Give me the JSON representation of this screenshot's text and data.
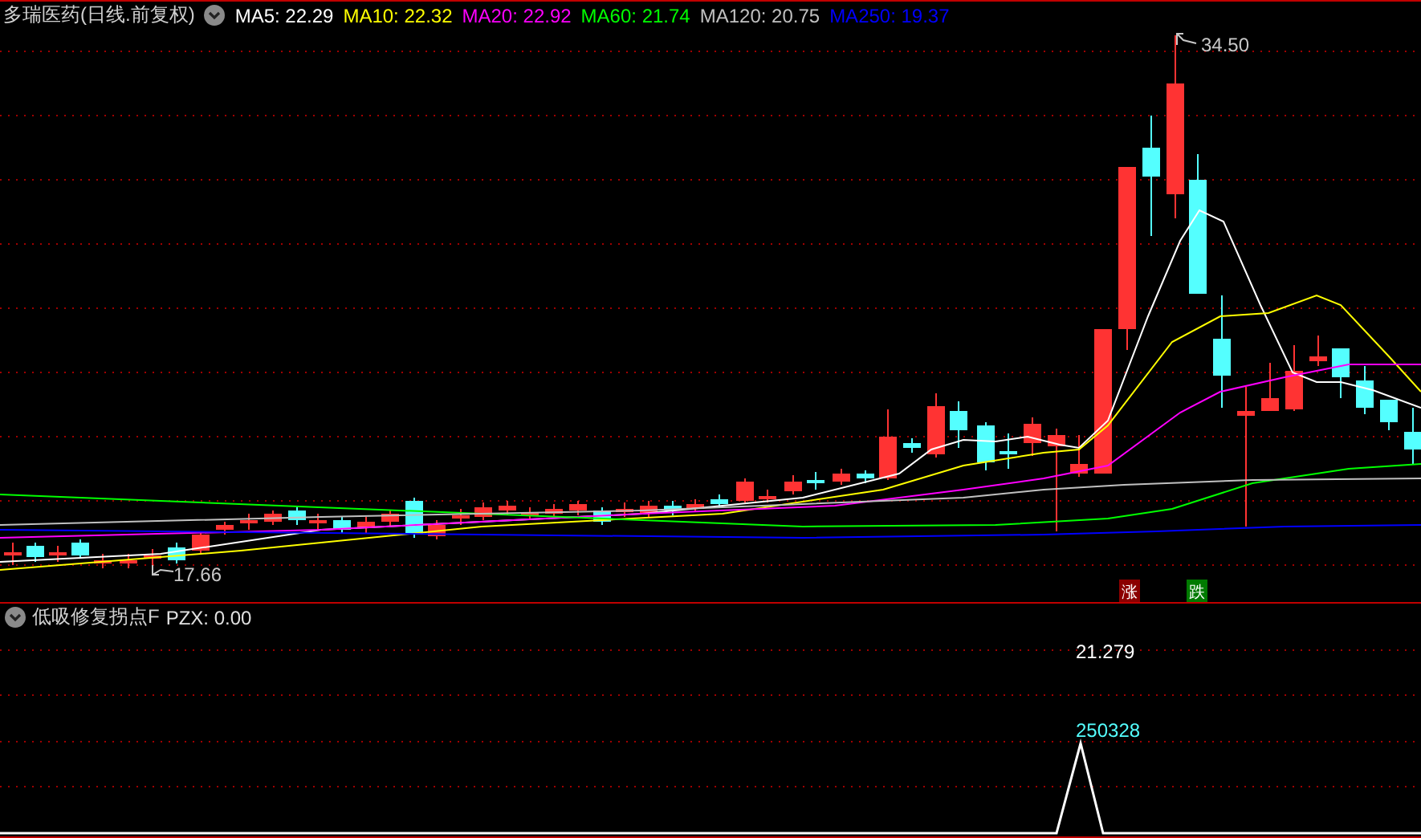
{
  "title": "多瑞医药",
  "period": "(日线.前复权)",
  "ma": [
    {
      "label": "MA5: 22.29",
      "color": "#ffffff"
    },
    {
      "label": "MA10: 22.32",
      "color": "#ffff00"
    },
    {
      "label": "MA20: 22.92",
      "color": "#ff00ff"
    },
    {
      "label": "MA60: 21.74",
      "color": "#00ff00"
    },
    {
      "label": "MA120: 20.75",
      "color": "#c0c0c0"
    },
    {
      "label": "MA250: 19.37",
      "color": "#0000ff"
    }
  ],
  "high_label": "34.50",
  "low_label": "17.66",
  "signals": [
    {
      "text": "涨",
      "kind": "rise"
    },
    {
      "text": "跌",
      "kind": "fall"
    }
  ],
  "indicator": {
    "name": "低吸修复拐点F",
    "reading": "PZX: 0.00",
    "value_label": "21.279",
    "peak_label": "250328"
  }
}
